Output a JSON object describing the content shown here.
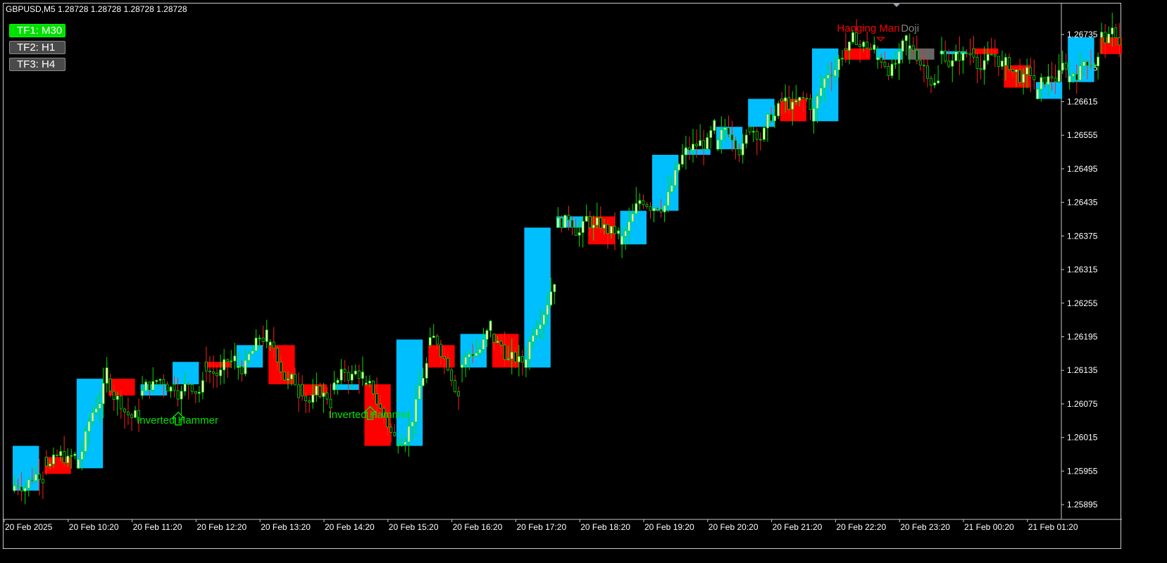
{
  "window": {
    "symbol_info": "GBPUSD,M5  1.28728 1.28728 1.28728 1.28728"
  },
  "timeframe_buttons": [
    {
      "label": "TF1: M30",
      "active": true
    },
    {
      "label": "TF2: H1",
      "active": false
    },
    {
      "label": "TF3: H4",
      "active": false
    }
  ],
  "colors": {
    "background": "#000000",
    "bull_box": "#00bfff",
    "bear_box": "#ff0000",
    "doji_box": "#666666",
    "candle_up_body": "#ffffc0",
    "candle_outline": "#00e000",
    "candle_bear_wick": "#ff2020",
    "axis_text": "#ffffff",
    "pattern_bull": "#00e000",
    "pattern_bear": "#ff0000",
    "pattern_doji": "#808080"
  },
  "chart_data": {
    "type": "candlestick",
    "symbol": "GBPUSD",
    "timeframe": "M5",
    "ylim": [
      1.2586,
      1.2677
    ],
    "price_ticks": [
      1.26735,
      1.26675,
      1.26615,
      1.26555,
      1.26495,
      1.26435,
      1.26375,
      1.26315,
      1.26255,
      1.26195,
      1.26135,
      1.26075,
      1.26015,
      1.25955,
      1.25895
    ],
    "time_ticks": [
      "20 Feb 2025",
      "20 Feb 10:20",
      "20 Feb 11:20",
      "20 Feb 12:20",
      "20 Feb 13:20",
      "20 Feb 14:20",
      "20 Feb 15:20",
      "20 Feb 16:20",
      "20 Feb 17:20",
      "20 Feb 18:20",
      "20 Feb 19:20",
      "20 Feb 20:20",
      "20 Feb 21:20",
      "20 Feb 22:20",
      "20 Feb 23:20",
      "21 Feb 00:20",
      "21 Feb 01:20"
    ],
    "htf_boxes": [
      {
        "slot": 0,
        "open": 1.2592,
        "close": 1.26,
        "dir": "bull"
      },
      {
        "slot": 1,
        "open": 1.2598,
        "close": 1.2595,
        "dir": "bear"
      },
      {
        "slot": 2,
        "open": 1.2596,
        "close": 1.2612,
        "dir": "bull"
      },
      {
        "slot": 3,
        "open": 1.2612,
        "close": 1.2609,
        "dir": "bear"
      },
      {
        "slot": 4,
        "open": 1.2609,
        "close": 1.2611,
        "dir": "bull"
      },
      {
        "slot": 5,
        "open": 1.2611,
        "close": 1.2615,
        "dir": "bull"
      },
      {
        "slot": 6,
        "open": 1.2615,
        "close": 1.2614,
        "dir": "bear"
      },
      {
        "slot": 7,
        "open": 1.2614,
        "close": 1.2618,
        "dir": "bull"
      },
      {
        "slot": 8,
        "open": 1.2618,
        "close": 1.2611,
        "dir": "bear"
      },
      {
        "slot": 9,
        "open": 1.2611,
        "close": 1.2609,
        "dir": "bear"
      },
      {
        "slot": 10,
        "open": 1.261,
        "close": 1.2611,
        "dir": "bull"
      },
      {
        "slot": 11,
        "open": 1.2611,
        "close": 1.26,
        "dir": "bear"
      },
      {
        "slot": 12,
        "open": 1.26,
        "close": 1.2619,
        "dir": "bull"
      },
      {
        "slot": 13,
        "open": 1.2618,
        "close": 1.2614,
        "dir": "bear"
      },
      {
        "slot": 14,
        "open": 1.2614,
        "close": 1.262,
        "dir": "bull"
      },
      {
        "slot": 15,
        "open": 1.262,
        "close": 1.2614,
        "dir": "bear"
      },
      {
        "slot": 16,
        "open": 1.2614,
        "close": 1.2639,
        "dir": "bull"
      },
      {
        "slot": 17,
        "open": 1.2639,
        "close": 1.2641,
        "dir": "bull"
      },
      {
        "slot": 18,
        "open": 1.2641,
        "close": 1.2636,
        "dir": "bear"
      },
      {
        "slot": 19,
        "open": 1.2636,
        "close": 1.2642,
        "dir": "bull"
      },
      {
        "slot": 20,
        "open": 1.2642,
        "close": 1.2652,
        "dir": "bull"
      },
      {
        "slot": 21,
        "open": 1.2652,
        "close": 1.2653,
        "dir": "bull"
      },
      {
        "slot": 22,
        "open": 1.2653,
        "close": 1.2657,
        "dir": "bull"
      },
      {
        "slot": 23,
        "open": 1.2657,
        "close": 1.2662,
        "dir": "bull"
      },
      {
        "slot": 24,
        "open": 1.2662,
        "close": 1.2658,
        "dir": "bear"
      },
      {
        "slot": 25,
        "open": 1.2658,
        "close": 1.2671,
        "dir": "bull"
      },
      {
        "slot": 26,
        "open": 1.2671,
        "close": 1.2669,
        "dir": "bear"
      },
      {
        "slot": 27,
        "open": 1.2669,
        "close": 1.2671,
        "dir": "bull"
      },
      {
        "slot": 28,
        "open": 1.2671,
        "close": 1.2669,
        "dir": "doji"
      },
      {
        "slot": 29,
        "open": 1.267,
        "close": 1.26705,
        "dir": "bull"
      },
      {
        "slot": 30,
        "open": 1.2671,
        "close": 1.267,
        "dir": "bear"
      },
      {
        "slot": 31,
        "open": 1.2668,
        "close": 1.2664,
        "dir": "bear"
      },
      {
        "slot": 32,
        "open": 1.2662,
        "close": 1.2665,
        "dir": "bull"
      },
      {
        "slot": 33,
        "open": 1.2665,
        "close": 1.2673,
        "dir": "bull"
      },
      {
        "slot": 34,
        "open": 1.2673,
        "close": 1.267,
        "dir": "bear"
      }
    ],
    "patterns": [
      {
        "label": "Inverted Hammer",
        "slot": 4.1,
        "price": 1.26045,
        "kind": "bull"
      },
      {
        "label": "Inverted Hammer",
        "slot": 10.1,
        "price": 1.26055,
        "kind": "bull"
      },
      {
        "label": "Hanging Man",
        "slot": 26.0,
        "price": 1.26745,
        "kind": "bear"
      },
      {
        "label": "Doji",
        "slot": 28.0,
        "price": 1.26745,
        "kind": "doji"
      }
    ]
  }
}
